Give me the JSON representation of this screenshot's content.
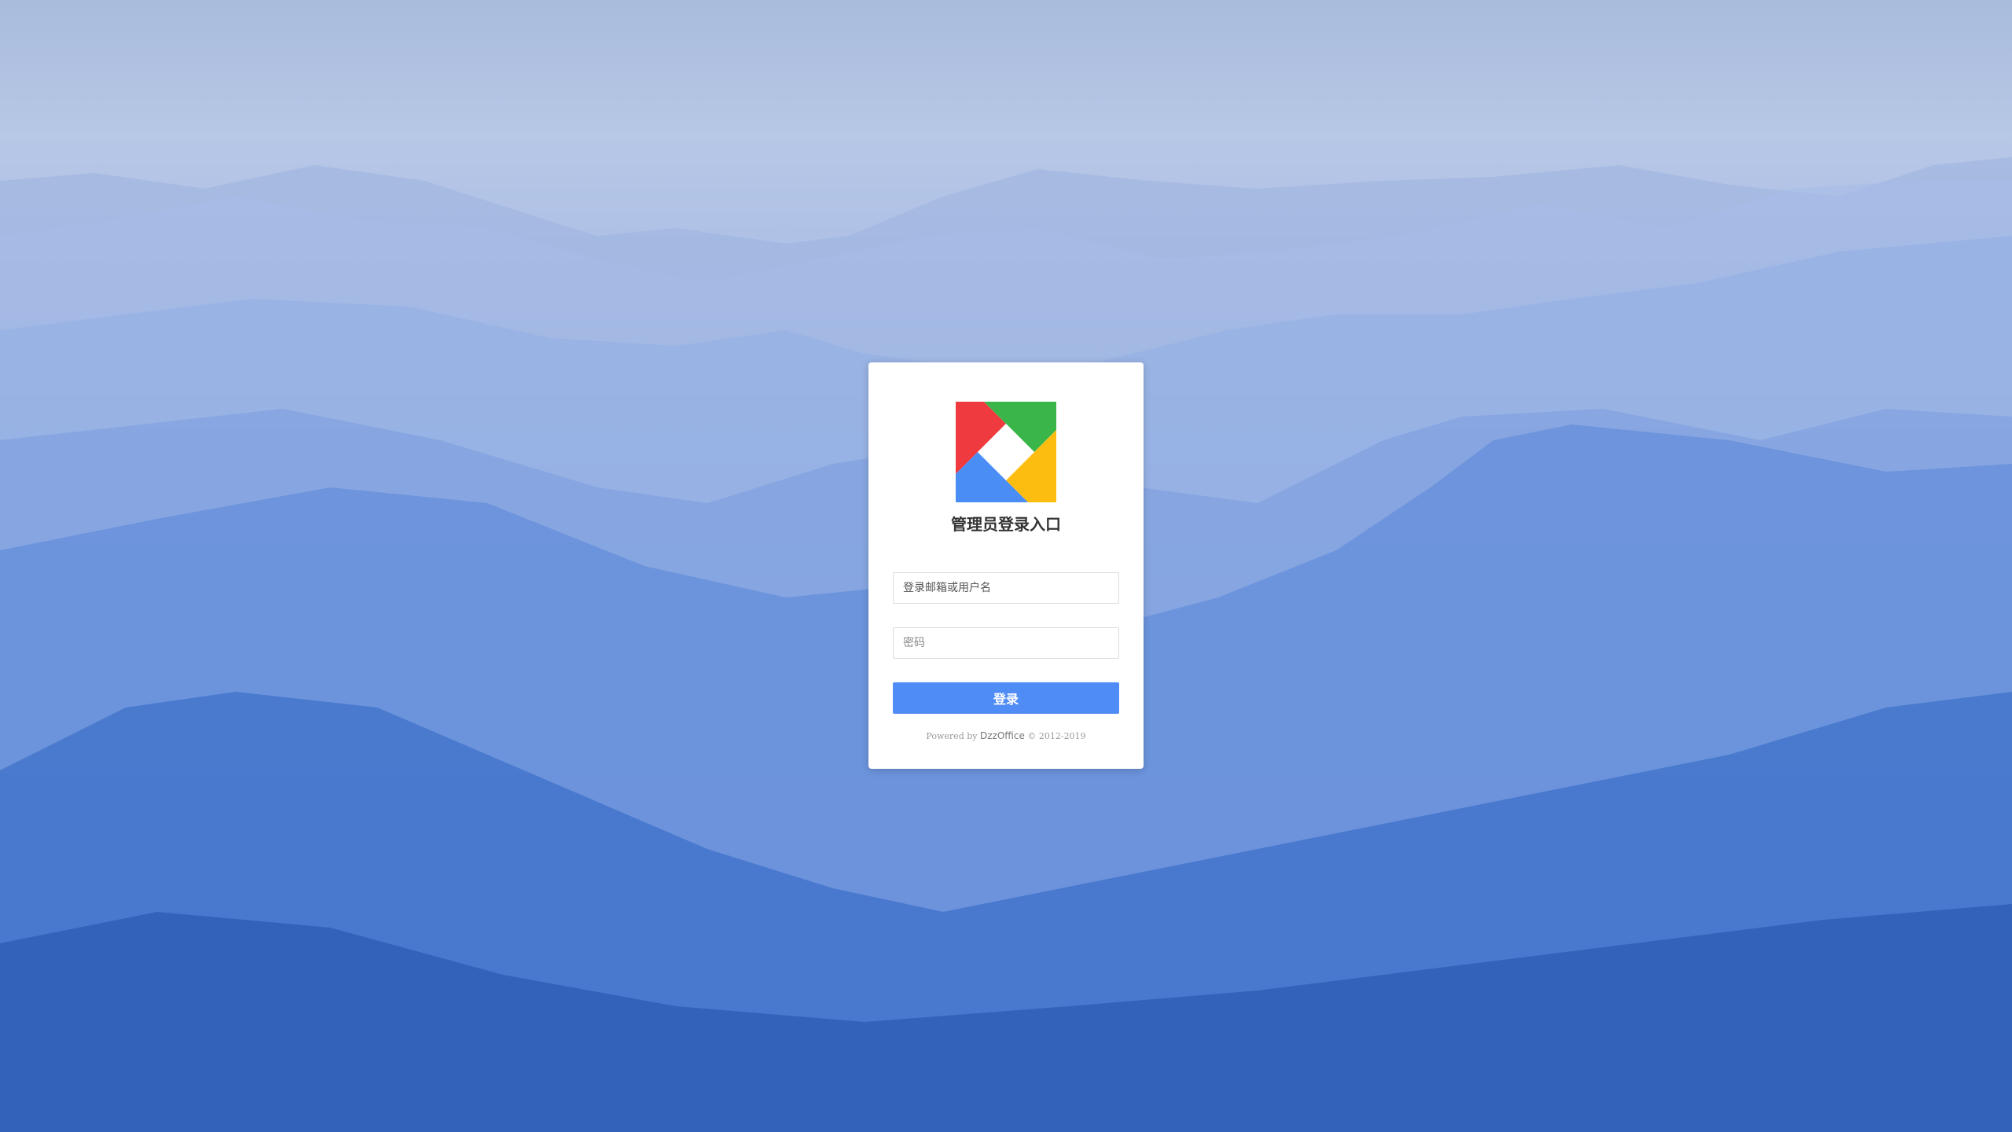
{
  "login": {
    "title": "管理员登录入口",
    "username_placeholder": "登录邮箱或用户名",
    "password_placeholder": "密码",
    "submit_label": "登录"
  },
  "footer": {
    "prefix": "Powered by ",
    "brand": "DzzOffice",
    "suffix": " © 2012-2019"
  },
  "colors": {
    "button": "#4f8cf5",
    "logo_red": "#ef3a3f",
    "logo_green": "#3ab54a",
    "logo_blue": "#4a8ef5",
    "logo_yellow": "#fdbd10"
  }
}
